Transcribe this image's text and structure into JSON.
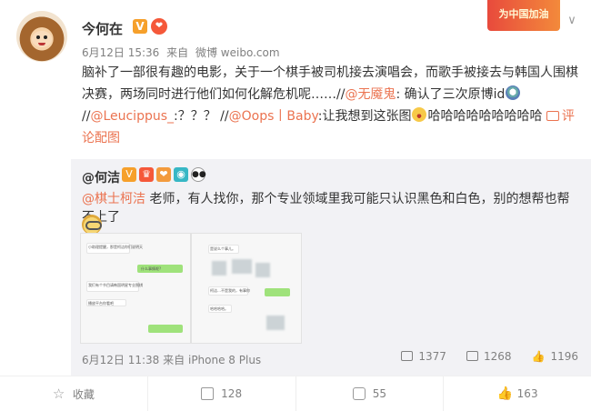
{
  "post": {
    "author": "今何在",
    "verified_badge": "V",
    "date": "6月12日 15:36",
    "source_prefix": "来自",
    "source": "微博 weibo.com",
    "promo_label": "为中国加油",
    "text_1": "脑补了一部很有趣的电影，关于一个棋手被司机接去演唱会，而歌手被接去与韩国人围棋决赛，两场同时进行他们如何化解危机呢……//",
    "mention_1": "@无魇鬼",
    "text_2": ": 确认了三次原博id",
    "text_3": "//",
    "mention_2": "@Leucippus_",
    "text_4": ":？？？ //",
    "mention_3": "@Oops丨Baby",
    "text_5": ":让我想到这张图",
    "text_6": "哈哈哈哈哈哈哈哈哈",
    "view_image_label": "评论配图"
  },
  "retweet": {
    "author": "@何洁",
    "mention": "@棋士柯洁",
    "text": " 老师，有人找你，那个专业领域里我可能只认识黑色和白色，别的想帮也帮不上了",
    "date": "6月12日 11:38",
    "source_prefix": "来自",
    "source": "iPhone 8 Plus",
    "forward_count": "1377",
    "comment_count": "1268",
    "like_count": "1196",
    "chat1_lines": [
      "小助理提醒，那是柯洁你们说明天是韩国比赛表示40你",
      "什么事情呢?",
      "我们有个节目请韩国明星专业围棋的邀请",
      "播放平台你看吧"
    ],
    "chat2_lines": [
      "是说么个事儿。",
      "柯洁…不是我的，有事你",
      "哈哈哈哈。"
    ]
  },
  "footer": {
    "favorite_label": "收藏",
    "forward_count": "128",
    "comment_count": "55",
    "like_count": "163"
  }
}
